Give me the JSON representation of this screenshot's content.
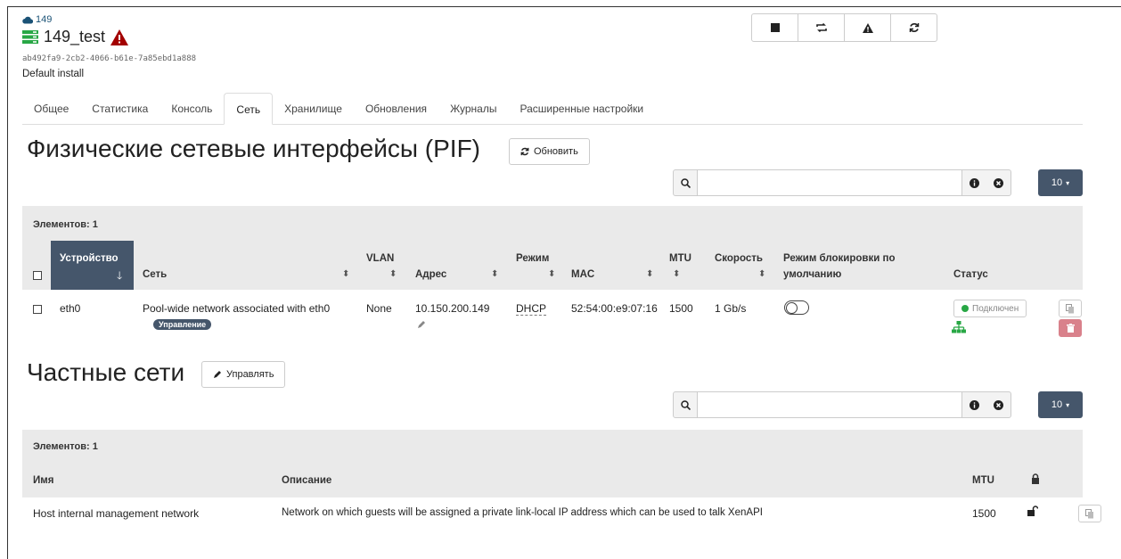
{
  "header": {
    "pool_name": "149",
    "host_name": "149_test",
    "uuid": "ab492fa9-2cb2-4066-b61e-7a85ebd1a888",
    "description": "Default install"
  },
  "toolbar": [
    {
      "name": "stop-icon"
    },
    {
      "name": "restart-toolstack-icon"
    },
    {
      "name": "warning-icon"
    },
    {
      "name": "reboot-icon"
    }
  ],
  "tabs": [
    "Общее",
    "Статистика",
    "Консоль",
    "Сеть",
    "Хранилище",
    "Обновления",
    "Журналы",
    "Расширенные настройки"
  ],
  "active_tab": "Сеть",
  "pif": {
    "title": "Физические сетевые интерфейсы (PIF)",
    "refresh_label": "Обновить",
    "page_size": "10",
    "count_label": "Элементов: 1",
    "columns": {
      "device": "Устройство",
      "network": "Сеть",
      "vlan": "VLAN",
      "address": "Адрес",
      "mode": "Режим",
      "mac": "MAC",
      "mtu": "MTU",
      "speed": "Скорость",
      "lock_mode_1": "Режим блокировки по",
      "lock_mode_2": "умолчанию",
      "status": "Статус"
    },
    "rows": [
      {
        "device": "eth0",
        "network": "Pool-wide network associated with eth0",
        "network_tag": "Управление",
        "vlan": "None",
        "address": "10.150.200.149",
        "mode": "DHCP",
        "mac": "52:54:00:e9:07:16",
        "mtu": "1500",
        "speed": "1 Gb/s",
        "status": "Подключен"
      }
    ]
  },
  "private": {
    "title": "Частные сети",
    "manage_label": "Управлять",
    "page_size": "10",
    "count_label": "Элементов: 1",
    "columns": {
      "name": "Имя",
      "description": "Описание",
      "mtu": "MTU"
    },
    "rows": [
      {
        "name": "Host internal management network",
        "description": "Network on which guests will be assigned a private link-local IP address which can be used to talk XenAPI",
        "mtu": "1500"
      }
    ]
  },
  "colors": {
    "accent": "#45566b",
    "host_green": "#28a745",
    "warning_red": "#a30000",
    "danger": "#d9818b"
  }
}
